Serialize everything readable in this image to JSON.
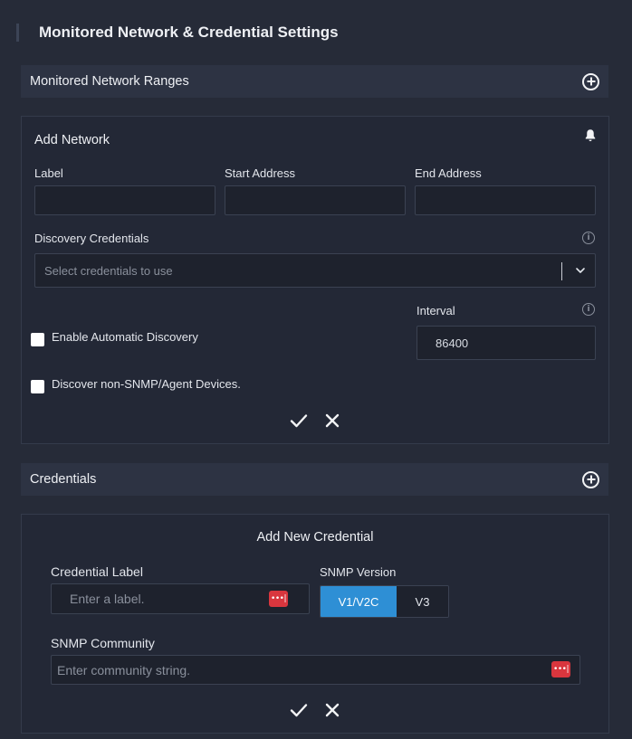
{
  "page": {
    "title": "Monitored Network & Credential Settings"
  },
  "monitored_ranges": {
    "label": "Monitored Network Ranges",
    "add_icon": "plus-circle-icon"
  },
  "add_network": {
    "title": "Add Network",
    "notify_icon": "bell-icon",
    "label_field": {
      "label": "Label",
      "value": ""
    },
    "start_address": {
      "label": "Start Address",
      "value": ""
    },
    "end_address": {
      "label": "End Address",
      "value": ""
    },
    "discovery_credentials": {
      "label": "Discovery Credentials",
      "placeholder": "Select credentials to use"
    },
    "interval": {
      "label": "Interval",
      "value": "86400"
    },
    "enable_auto_discovery": {
      "label": "Enable Automatic Discovery",
      "checked": false
    },
    "discover_non_snmp": {
      "label": "Discover non-SNMP/Agent Devices.",
      "checked": false
    }
  },
  "credentials": {
    "label": "Credentials",
    "add_icon": "plus-circle-icon"
  },
  "add_credential": {
    "title": "Add New Credential",
    "credential_label": {
      "label": "Credential Label",
      "placeholder": "Enter a label."
    },
    "snmp_version": {
      "label": "SNMP Version",
      "options": [
        "V1/V2C",
        "V3"
      ],
      "selected": "V1/V2C"
    },
    "snmp_community": {
      "label": "SNMP Community",
      "placeholder": "Enter community string."
    }
  },
  "colors": {
    "accent": "#2e8fd5",
    "background": "#262b38",
    "panel": "#232836",
    "badge": "#d9363e"
  }
}
